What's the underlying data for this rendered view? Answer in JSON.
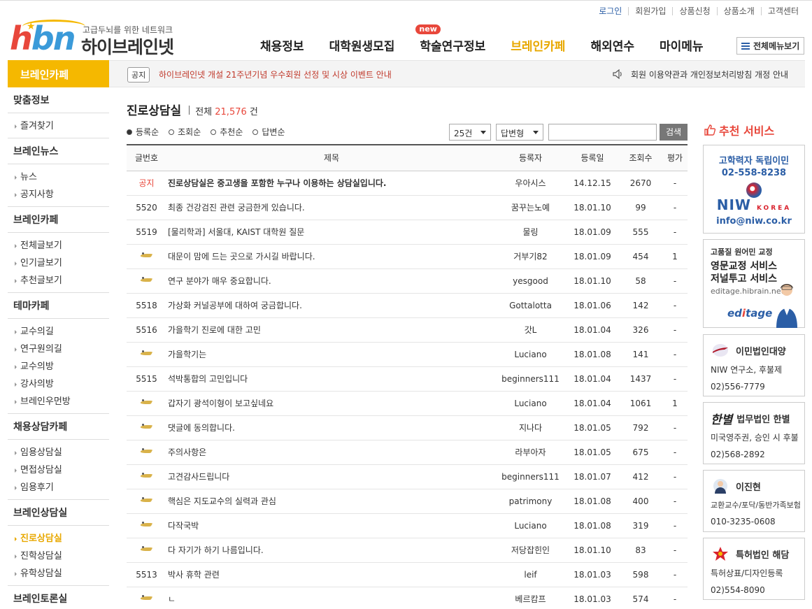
{
  "util_links": [
    "로그인",
    "회원가입",
    "상품신청",
    "상품소개",
    "고객센터"
  ],
  "logo": {
    "tagline": "고급두뇌를 위한 네트워크",
    "name": "하이브레인넷"
  },
  "gnb": [
    {
      "label": "채용정보"
    },
    {
      "label": "대학원생모집"
    },
    {
      "label": "학술연구정보",
      "badge": "new"
    },
    {
      "label": "브레인카페"
    },
    {
      "label": "해외연수"
    },
    {
      "label": "마이메뉴"
    }
  ],
  "all_menu_label": "전체메뉴보기",
  "section_title": "브레인카페",
  "notice": {
    "tag": "공지",
    "text": "하이브레인넷 개설 21주년기념 우수회원 선정 및 시상 이벤트 안내",
    "right_text": "회원 이용약관과 개인정보처리방침 개정 안내"
  },
  "lnb": [
    {
      "group": "맞춤정보",
      "links": [
        "즐겨찾기"
      ]
    },
    {
      "group": "브레인뉴스",
      "links": [
        "뉴스",
        "공지사항"
      ]
    },
    {
      "group": "브레인카페",
      "links": [
        "전체글보기",
        "인기글보기",
        "추천글보기"
      ]
    },
    {
      "group": "테마카페",
      "links": [
        "교수의길",
        "연구원의길",
        "교수의방",
        "강사의방",
        "브레인우먼방"
      ]
    },
    {
      "group": "채용상담카페",
      "links": [
        "임용상담실",
        "면접상담실",
        "임용후기"
      ]
    },
    {
      "group": "브레인상담실",
      "links": [
        "진로상담실",
        "진학상담실",
        "유학상담실"
      ]
    },
    {
      "group": "브레인토론실",
      "links": []
    }
  ],
  "board": {
    "title": "진로상담실",
    "count_prefix": "전체",
    "count": "21,576",
    "count_suffix": "건",
    "sort_options": [
      "등록순",
      "조회순",
      "추천순",
      "답변순"
    ],
    "page_size": "25건",
    "view_type": "답변형",
    "search_value": "",
    "search_button": "검색",
    "headers": [
      "글번호",
      "제목",
      "등록자",
      "등록일",
      "조회수",
      "평가"
    ],
    "rows": [
      {
        "num": "공지",
        "title": "진로상담실은 중고생을 포함한 누구나 이용하는 상담실입니다.",
        "writer": "우아시스",
        "date": "14.12.15",
        "views": "2670",
        "rate": "-",
        "notice": true
      },
      {
        "num": "5520",
        "title": "최종 건강검진 관련 궁금한게 있습니다.",
        "writer": "꿈꾸는노예",
        "date": "18.01.10",
        "views": "99",
        "rate": "-"
      },
      {
        "num": "5519",
        "title": "[물리학과] 서울대, KAIST 대학원 질문",
        "writer": "물링",
        "date": "18.01.09",
        "views": "555",
        "rate": "-"
      },
      {
        "num": "",
        "title": "대문이 맘에 드는 곳으로 가시길 바랍니다.",
        "writer": "거부기82",
        "date": "18.01.09",
        "views": "454",
        "rate": "1",
        "reply": true
      },
      {
        "num": "",
        "title": "연구 분야가 매우 중요합니다.",
        "writer": "yesgood",
        "date": "18.01.10",
        "views": "58",
        "rate": "-",
        "reply": true
      },
      {
        "num": "5518",
        "title": "가상화 커널공부에 대하여 궁금합니다.",
        "writer": "Gottalotta",
        "date": "18.01.06",
        "views": "142",
        "rate": "-"
      },
      {
        "num": "5516",
        "title": "가을학기 진로에 대한 고민",
        "writer": "갓L",
        "date": "18.01.04",
        "views": "326",
        "rate": "-"
      },
      {
        "num": "",
        "title": "가을학기는",
        "writer": "Luciano",
        "date": "18.01.08",
        "views": "141",
        "rate": "-",
        "reply": true
      },
      {
        "num": "5515",
        "title": "석박통합의 고민입니다",
        "writer": "beginners111",
        "date": "18.01.04",
        "views": "1437",
        "rate": "-"
      },
      {
        "num": "",
        "title": "갑자기 광석이형이 보고싶네요",
        "writer": "Luciano",
        "date": "18.01.04",
        "views": "1061",
        "rate": "1",
        "reply": true
      },
      {
        "num": "",
        "title": "댓글에 동의합니다.",
        "writer": "지나다",
        "date": "18.01.05",
        "views": "792",
        "rate": "-",
        "reply": true
      },
      {
        "num": "",
        "title": "주의사항은",
        "writer": "라부아자",
        "date": "18.01.05",
        "views": "675",
        "rate": "-",
        "reply": true
      },
      {
        "num": "",
        "title": "고견감사드립니다",
        "writer": "beginners111",
        "date": "18.01.07",
        "views": "412",
        "rate": "-",
        "reply": true
      },
      {
        "num": "",
        "title": "핵심은 지도교수의 실력과 관심",
        "writer": "patrimony",
        "date": "18.01.08",
        "views": "400",
        "rate": "-",
        "reply": true
      },
      {
        "num": "",
        "title": "다작국박",
        "writer": "Luciano",
        "date": "18.01.08",
        "views": "319",
        "rate": "-",
        "reply": true
      },
      {
        "num": "",
        "title": "다 자기가 하기 나름입니다.",
        "writer": "저당잡힌인",
        "date": "18.01.10",
        "views": "83",
        "rate": "-",
        "reply": true
      },
      {
        "num": "5513",
        "title": "박사 휴학 관련",
        "writer": "leif",
        "date": "18.01.03",
        "views": "598",
        "rate": "-"
      },
      {
        "num": "",
        "title": "ㄴ",
        "writer": "베르캄프",
        "date": "18.01.03",
        "views": "574",
        "rate": "-",
        "reply": true
      }
    ]
  },
  "recommend": {
    "title": "추천 서비스",
    "ad1": {
      "line1": "고학력자 독립이민",
      "line2": "02-558-8238",
      "brand": "NIW",
      "brand_sub": "KOREA",
      "email": "info@niw.co.kr"
    },
    "ad2": {
      "line1": "고품질 원어민 교정",
      "line2": "영문교정 서비스",
      "line3": "저널투고 서비스",
      "url": "editage.hibrain.net",
      "brand_a": "ed",
      "brand_b": "i",
      "brand_c": "tage"
    },
    "ad3": {
      "name": "이민법인대양",
      "line1": "NIW 연구소, 후불제",
      "line2": "02)556-7779"
    },
    "ad4": {
      "name": "법무법인 한별",
      "logo_text": "한별",
      "line1": "미국영주권, 승인 시 후불",
      "line2": "02)568-2892"
    },
    "ad5": {
      "name": "이진현",
      "line1": "교환교수/포닥/동반가족보험",
      "line2": "010-3235-0608"
    },
    "ad6": {
      "name": "특허법인 해담",
      "line1": "특허상표/디자인등록",
      "line2": "02)554-8090"
    }
  },
  "colors": {
    "accent": "#f5b800",
    "highlight": "#e8473b",
    "link_blue": "#2b5ea6"
  }
}
